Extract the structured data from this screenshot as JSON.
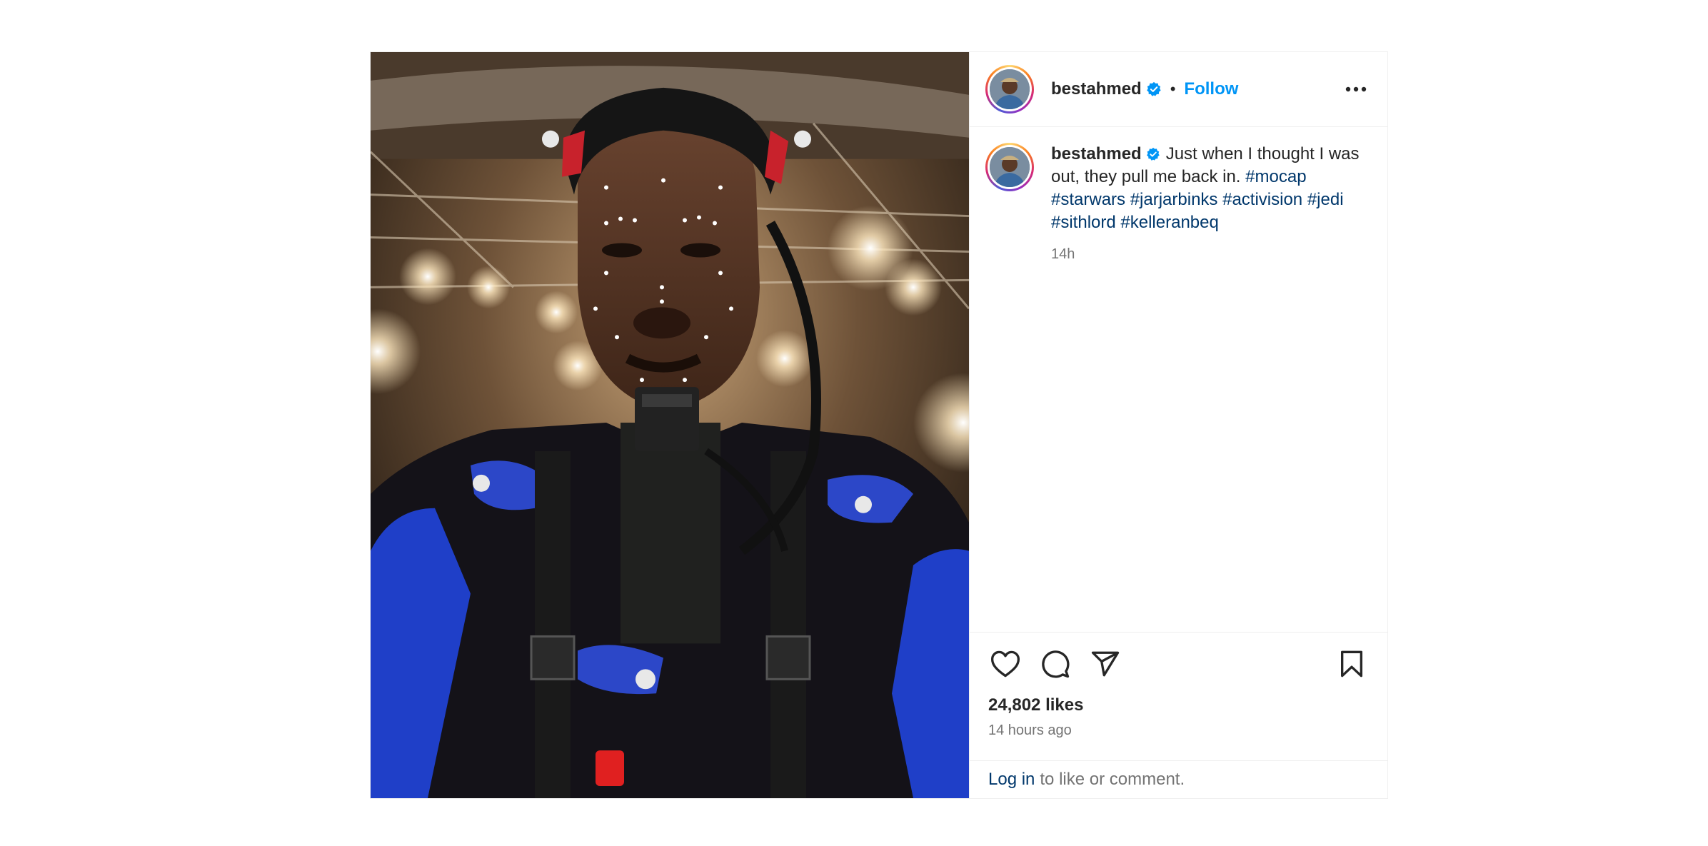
{
  "post": {
    "username": "bestahmed",
    "follow_label": "Follow",
    "separator": "•",
    "caption_text": "Just when I thought I was out, they pull me back in.",
    "hashtags": [
      "#mocap",
      "#starwars",
      "#jarjarbinks",
      "#activision",
      "#jedi",
      "#sithlord",
      "#kelleranbeq"
    ],
    "caption_age": "14h",
    "likes": "24,802 likes",
    "time_ago": "14 hours ago"
  },
  "login": {
    "link": "Log in",
    "rest": "to like or comment."
  },
  "colors": {
    "link_blue": "#0095f6",
    "hashtag_blue": "#00376b",
    "verified_blue": "#0095f6",
    "muted": "#737373"
  },
  "icons": [
    "more-options-icon",
    "heart-icon",
    "comment-icon",
    "share-icon",
    "bookmark-icon",
    "verified-icon"
  ]
}
